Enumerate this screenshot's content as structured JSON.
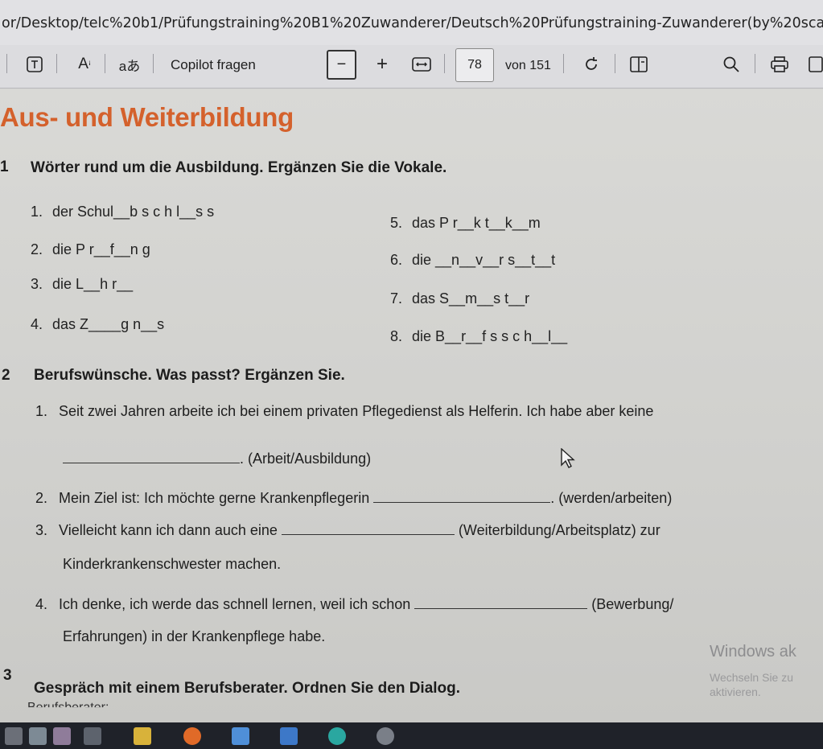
{
  "url": "or/Desktop/telc%20b1/Prüfungstraining%20B1%20Zuwanderer/Deutsch%20Prüfungstraining-Zuwanderer(by%20scanner).pd",
  "toolbar": {
    "copilot_label": "Copilot fragen",
    "zoom_minus": "−",
    "zoom_plus": "+",
    "page_current": "78",
    "page_total": "von 151"
  },
  "document": {
    "heading": "Aus- und Weiterbildung",
    "ex1": {
      "num": "1",
      "title": "Wörter rund um die Ausbildung. Ergänzen Sie die Vokale.",
      "items": [
        {
          "n": "1.",
          "text": "der Schul__b s c h l__s s"
        },
        {
          "n": "2.",
          "text": "die P r__f__n g"
        },
        {
          "n": "3.",
          "text": "die L__h r__"
        },
        {
          "n": "4.",
          "text": "das Z____g n__s"
        },
        {
          "n": "5.",
          "text": "das P r__k t__k__m"
        },
        {
          "n": "6.",
          "text": "die __n__v__r s__t__t"
        },
        {
          "n": "7.",
          "text": "das S__m__s t__r"
        },
        {
          "n": "8.",
          "text": "die B__r__f s s c h__l__"
        }
      ]
    },
    "ex2": {
      "num": "2",
      "title": "Berufswünsche. Was passt? Ergänzen Sie.",
      "s1_n": "1.",
      "s1_a": "Seit zwei Jahren arbeite ich bei einem privaten Pflegedienst als Helferin. Ich habe aber keine",
      "s1_b": ". (Arbeit/Ausbildung)",
      "s2_n": "2.",
      "s2_a": "Mein Ziel ist: Ich möchte gerne Krankenpflegerin",
      "s2_b": ". (werden/arbeiten)",
      "s3_n": "3.",
      "s3_a": "Vielleicht kann ich dann auch eine",
      "s3_b": "(Weiterbildung/Arbeitsplatz) zur",
      "s3_c": "Kinderkrankenschwester machen.",
      "s4_n": "4.",
      "s4_a": "Ich denke, ich werde das schnell lernen, weil ich schon",
      "s4_b": "(Bewerbung/",
      "s4_c": "Erfahrungen) in der Krankenpflege habe."
    },
    "ex3": {
      "num": "3",
      "title": "Gespräch mit einem Berufsberater. Ordnen Sie den Dialog.",
      "cut_label": "Berufsberater:"
    },
    "watermark": {
      "line1": "Windows ak",
      "line2": "Wechseln Sie zu",
      "line3": "aktivieren."
    }
  },
  "colors": {
    "heading": "#d4612c",
    "taskbar": "#1f2229"
  }
}
